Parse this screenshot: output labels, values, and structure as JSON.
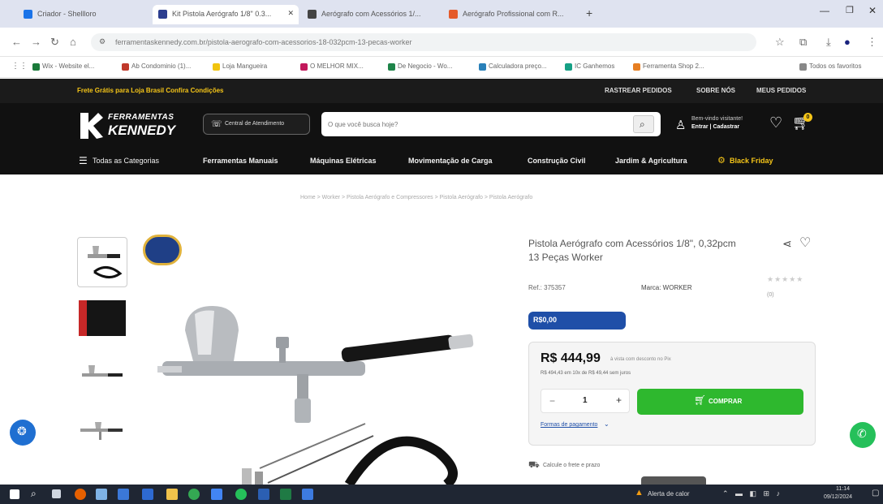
{
  "browser": {
    "tabs": [
      {
        "label": "Criador - Shellloro",
        "color": "#1a73e8"
      },
      {
        "label": "Kit Pistola Aerógrafo 1/8\" 0.3...",
        "color": "#2c3e8f"
      },
      {
        "label": "Aerógrafo com Acessórios 1/...",
        "color": "#444444"
      },
      {
        "label": "Aerógrafo Profissional com R...",
        "color": "#e55b2b"
      }
    ],
    "new_tab": "+",
    "url": "ferramentaskennedy.com.br/pistola-aerografo-com-acessorios-18-032pcm-13-pecas-worker",
    "bookmarks": [
      {
        "label": "Wix - Website el...",
        "color": "#1a7a3a"
      },
      {
        "label": "Ab Condominio (1)...",
        "color": "#c0392b"
      },
      {
        "label": "Loja Mangueira",
        "color": "#f1c40f"
      },
      {
        "label": "O MELHOR MIX...",
        "color": "#c2185b"
      },
      {
        "label": "De Negocio - Wo...",
        "color": "#1e8449"
      },
      {
        "label": "Calculadora preço...",
        "color": "#2980b9"
      },
      {
        "label": "IC Ganhemos",
        "color": "#16a085"
      },
      {
        "label": "Ferramenta Shop 2...",
        "color": "#e67e22"
      },
      {
        "label": "Todos os favoritos",
        "color": "#888888"
      }
    ]
  },
  "site": {
    "top_strip_left": "Frete Grátis para Loja Brasil Confira Condições",
    "top_links": [
      "RASTREAR PEDIDOS",
      "SOBRE NÓS",
      "MEUS PEDIDOS"
    ],
    "logo_line1": "FERRAMENTAS",
    "logo_line2": "KENNEDY",
    "cep_button": "Central de Atendimento",
    "search_placeholder": "O que você busca hoje?",
    "account_line1": "Bem-vindo visitante!",
    "account_line2": "Entrar | Cadastrar",
    "cart_count": "0",
    "categories": [
      "Todas as Categorias",
      "Ferramentas Manuais",
      "Máquinas Elétricas",
      "Movimentação de Carga",
      "Construção Civil",
      "Jardim & Agricultura",
      "Black Friday"
    ],
    "breadcrumb": "Home > Worker > Pistola Aerógrafo e Compressores > Pistola Aerógrafo > Pistola Aerógrafo"
  },
  "product": {
    "title": "Pistola Aerógrafo com Acessórios 1/8\", 0,32pcm 13 Peças Worker",
    "ref": "Ref.: 375357",
    "brand": "Marca: WORKER",
    "reviews": "(0)",
    "badge_price": "R$0,00",
    "price": "R$ 444,99",
    "price_note": "à vista com desconto no Pix",
    "installments": "R$ 494,43 em 10x de R$ 49,44 sem juros",
    "quantity": "1",
    "buy_button": "COMPRAR",
    "shipping_link": "Formas de pagamento",
    "delivery": "Calcule o frete e prazo"
  },
  "taskbar": {
    "weather": "Alerta de calor",
    "time": "11:14",
    "date": "09/12/2024"
  },
  "colors": {
    "buy_green": "#2eb82e",
    "badge_blue": "#1f4fa8",
    "float_blue": "#1f6fd1",
    "whatsapp": "#25c05a"
  }
}
